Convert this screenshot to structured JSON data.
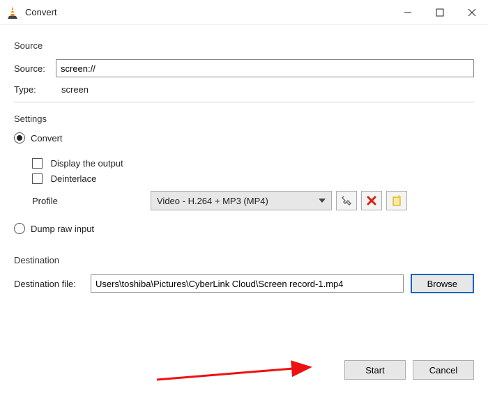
{
  "window": {
    "title": "Convert"
  },
  "sections": {
    "source": "Source",
    "settings": "Settings",
    "destination": "Destination"
  },
  "source": {
    "label": "Source:",
    "value": "screen://",
    "type_label": "Type:",
    "type_value": "screen"
  },
  "settings": {
    "convert_label": "Convert",
    "display_output_label": "Display the output",
    "deinterlace_label": "Deinterlace",
    "profile_label": "Profile",
    "profile_selected": "Video - H.264 + MP3 (MP4)",
    "dump_raw_label": "Dump raw input"
  },
  "destination": {
    "file_label": "Destination file:",
    "file_value": "Users\\toshiba\\Pictures\\CyberLink Cloud\\Screen record-1.mp4",
    "browse_label": "Browse"
  },
  "buttons": {
    "start": "Start",
    "cancel": "Cancel"
  },
  "icons": {
    "app": "vlc",
    "wrench": "tools-icon",
    "cross": "delete-icon",
    "new": "new-icon"
  }
}
